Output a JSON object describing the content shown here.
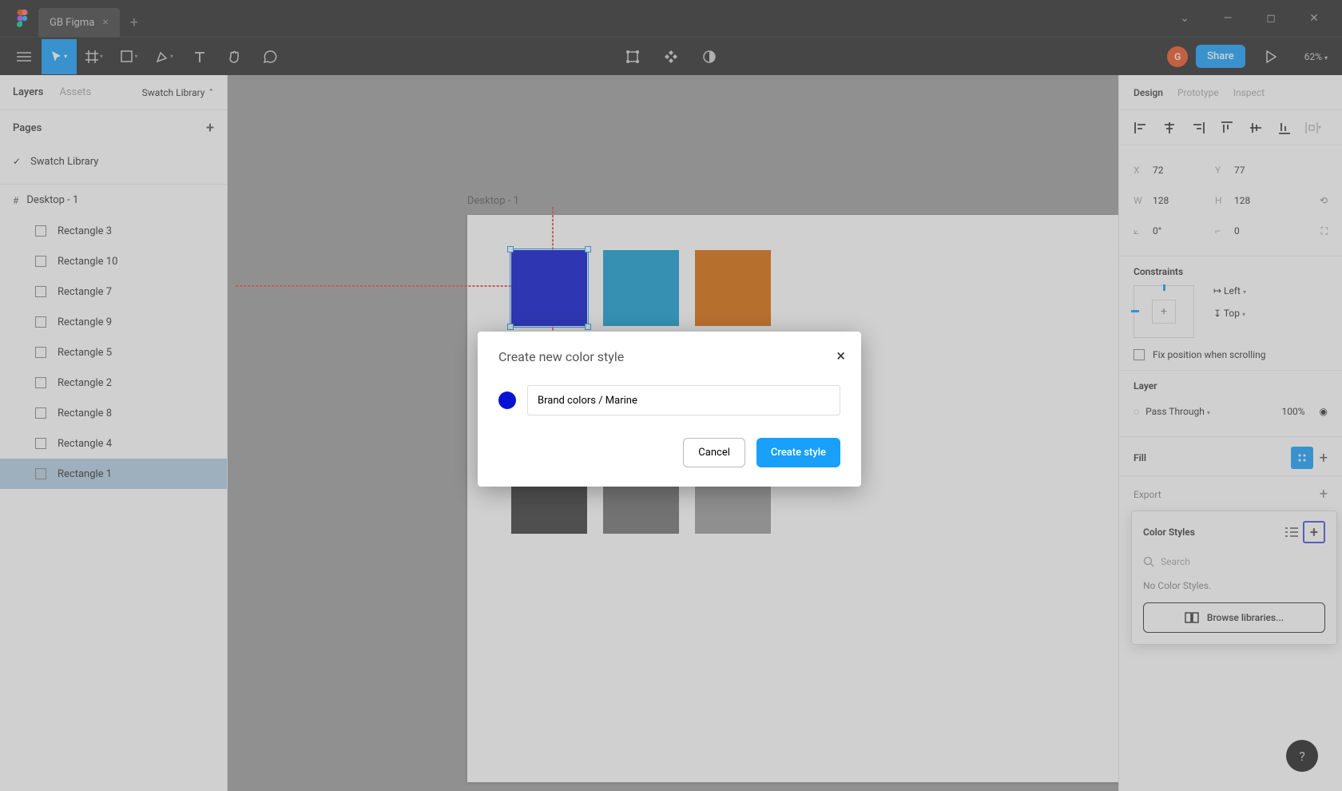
{
  "titlebar": {
    "tab_name": "GB Figma"
  },
  "toolbar": {
    "avatar_letter": "G",
    "share_label": "Share",
    "zoom_label": "62%"
  },
  "left_panel": {
    "tabs": {
      "layers": "Layers",
      "assets": "Assets"
    },
    "page_dropdown": "Swatch Library",
    "pages_title": "Pages",
    "current_page": "Swatch Library",
    "frame_name": "Desktop - 1",
    "layers": [
      "Rectangle 3",
      "Rectangle 10",
      "Rectangle 7",
      "Rectangle 9",
      "Rectangle 5",
      "Rectangle 2",
      "Rectangle 8",
      "Rectangle 4",
      "Rectangle 1"
    ]
  },
  "canvas": {
    "frame_label": "Desktop - 1",
    "selection_size": "128 × 128",
    "swatch_colors": [
      "#0713d2",
      "#129dd1",
      "#d96a06",
      "#0a0639",
      "#0c0f67",
      "#7273b5",
      "#3a3a3a",
      "#707070",
      "#9b9b9b"
    ]
  },
  "right_panel": {
    "tabs": {
      "design": "Design",
      "prototype": "Prototype",
      "inspect": "Inspect"
    },
    "pos": {
      "x_label": "X",
      "x": "72",
      "y_label": "Y",
      "y": "77",
      "w_label": "W",
      "w": "128",
      "h_label": "H",
      "h": "128",
      "rot_label": "",
      "rot": "0°",
      "rad_label": "",
      "rad": "0"
    },
    "constraints": {
      "title": "Constraints",
      "h": "Left",
      "v": "Top",
      "fix": "Fix position when scrolling"
    },
    "layer_section": {
      "title": "Layer",
      "blend": "Pass Through",
      "opacity": "100%"
    },
    "fill_title": "Fill",
    "color_styles": {
      "title": "Color Styles",
      "search_placeholder": "Search",
      "empty": "No Color Styles.",
      "browse": "Browse libraries..."
    },
    "export_title": "Export"
  },
  "modal": {
    "title": "Create new color style",
    "name_value": "Brand colors / Marine",
    "cancel": "Cancel",
    "submit": "Create style"
  }
}
